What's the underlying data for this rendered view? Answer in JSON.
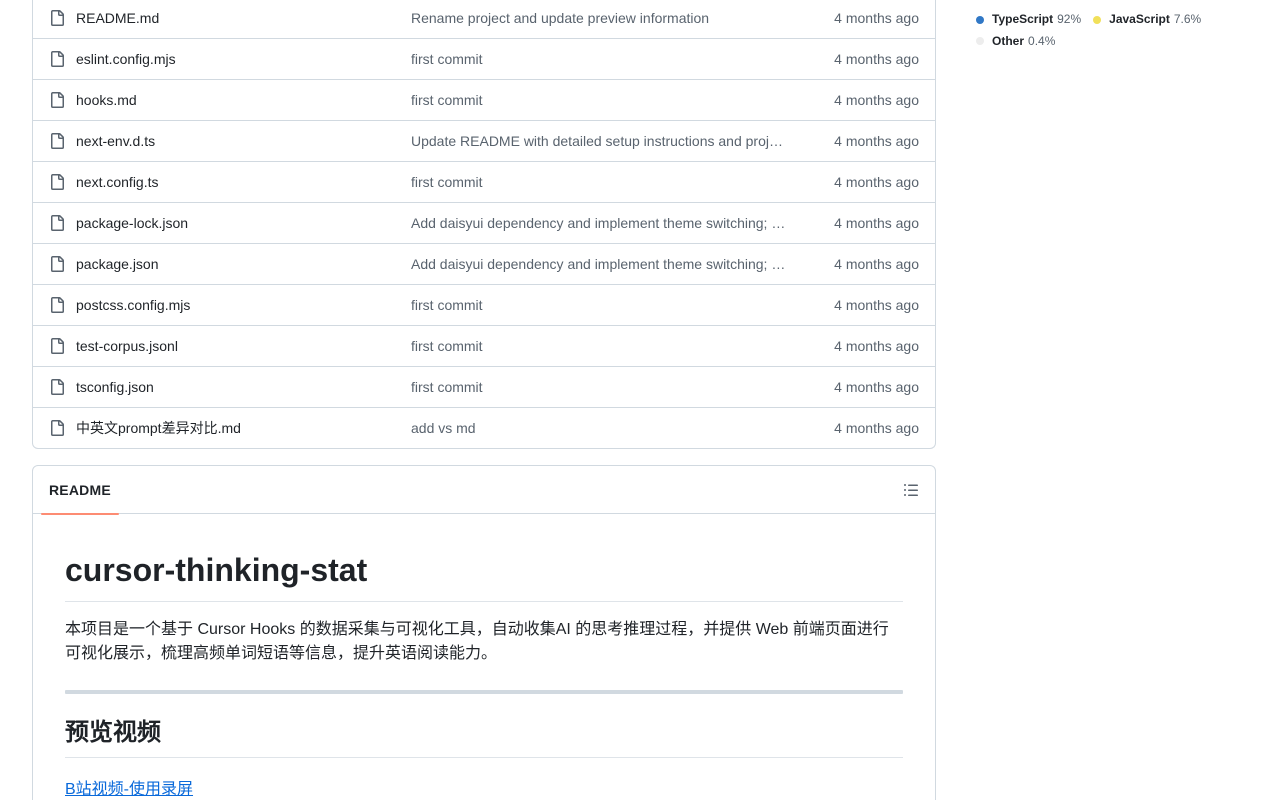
{
  "files": [
    {
      "name": "README.md",
      "commit": "Rename project and update preview information",
      "date": "4 months ago"
    },
    {
      "name": "eslint.config.mjs",
      "commit": "first commit",
      "date": "4 months ago"
    },
    {
      "name": "hooks.md",
      "commit": "first commit",
      "date": "4 months ago"
    },
    {
      "name": "next-env.d.ts",
      "commit": "Update README with detailed setup instructions and proj…",
      "date": "4 months ago"
    },
    {
      "name": "next.config.ts",
      "commit": "first commit",
      "date": "4 months ago"
    },
    {
      "name": "package-lock.json",
      "commit": "Add daisyui dependency and implement theme switching; …",
      "date": "4 months ago"
    },
    {
      "name": "package.json",
      "commit": "Add daisyui dependency and implement theme switching; …",
      "date": "4 months ago"
    },
    {
      "name": "postcss.config.mjs",
      "commit": "first commit",
      "date": "4 months ago"
    },
    {
      "name": "test-corpus.jsonl",
      "commit": "first commit",
      "date": "4 months ago"
    },
    {
      "name": "tsconfig.json",
      "commit": "first commit",
      "date": "4 months ago"
    },
    {
      "name": "中英文prompt差异对比.md",
      "commit": "add vs md",
      "date": "4 months ago"
    }
  ],
  "readme": {
    "tab_label": "README",
    "outline_icon": "list-unordered-icon",
    "title": "cursor-thinking-stat",
    "description": "本项目是一个基于 Cursor Hooks 的数据采集与可视化工具，自动收集AI 的思考推理过程，并提供 Web 前端页面进行可视化展示，梳理高频单词短语等信息，提升英语阅读能力。",
    "section_title": "预览视频",
    "link_text": "B站视频-使用录屏"
  },
  "languages": [
    {
      "name": "TypeScript",
      "percent": "92%",
      "color": "#3178c6"
    },
    {
      "name": "JavaScript",
      "percent": "7.6%",
      "color": "#f1e05a"
    },
    {
      "name": "Other",
      "percent": "0.4%",
      "color": "#ededed"
    }
  ]
}
